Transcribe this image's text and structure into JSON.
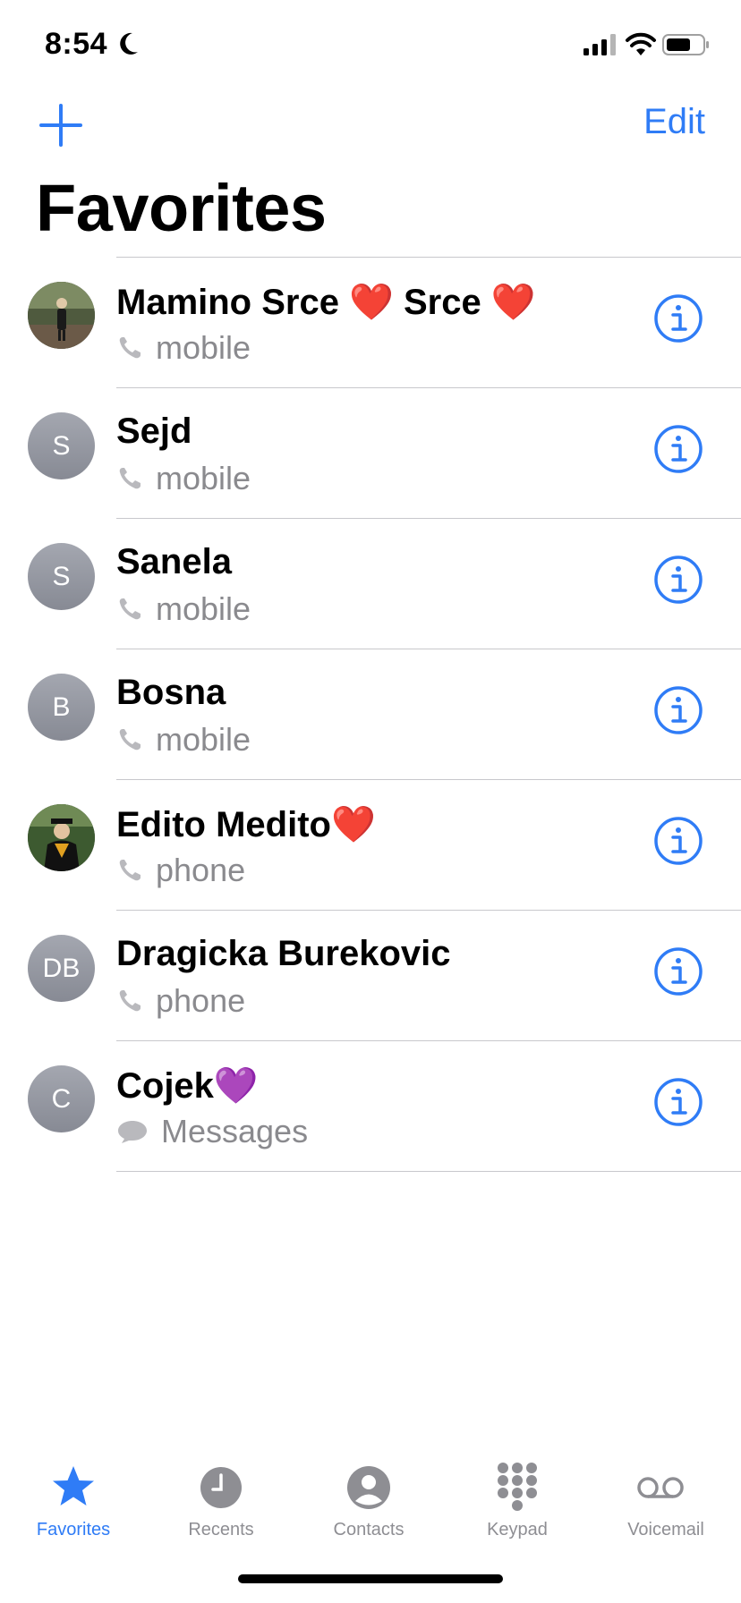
{
  "status": {
    "time": "8:54"
  },
  "nav": {
    "edit_label": "Edit",
    "title": "Favorites"
  },
  "colors": {
    "accent": "#2f7cf6",
    "secondary_text": "#8a8a8e",
    "divider": "#c8c8cc"
  },
  "favorites": [
    {
      "name": "Mamino Srce ❤️ Srce ❤️",
      "initials": "",
      "avatar": "photo",
      "sub_icon": "phone-icon",
      "sub_label": "mobile"
    },
    {
      "name": "Sejd",
      "initials": "S",
      "avatar": "initials",
      "sub_icon": "phone-icon",
      "sub_label": "mobile"
    },
    {
      "name": "Sanela",
      "initials": "S",
      "avatar": "initials",
      "sub_icon": "phone-icon",
      "sub_label": "mobile"
    },
    {
      "name": "Bosna",
      "initials": "B",
      "avatar": "initials",
      "sub_icon": "phone-icon",
      "sub_label": "mobile"
    },
    {
      "name": "Edito Medito❤️",
      "initials": "",
      "avatar": "photo",
      "sub_icon": "phone-icon",
      "sub_label": "phone"
    },
    {
      "name": "Dragicka Burekovic",
      "initials": "DB",
      "avatar": "initials",
      "sub_icon": "phone-icon",
      "sub_label": "phone"
    },
    {
      "name": "Cojek💜",
      "initials": "C",
      "avatar": "initials",
      "sub_icon": "message-bubble-icon",
      "sub_label": "Messages"
    }
  ],
  "tab_bar": {
    "tabs": [
      {
        "label": "Favorites",
        "icon": "star-icon",
        "active": true
      },
      {
        "label": "Recents",
        "icon": "clock-icon",
        "active": false
      },
      {
        "label": "Contacts",
        "icon": "person-circle-icon",
        "active": false
      },
      {
        "label": "Keypad",
        "icon": "keypad-icon",
        "active": false
      },
      {
        "label": "Voicemail",
        "icon": "voicemail-icon",
        "active": false
      }
    ]
  }
}
